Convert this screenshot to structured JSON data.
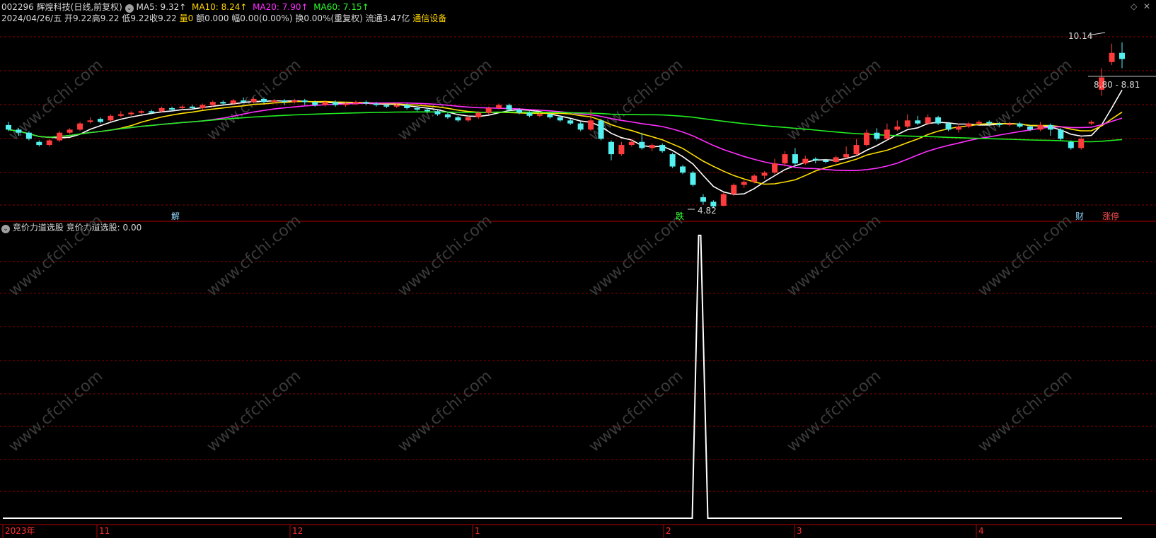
{
  "header": {
    "code": "002296",
    "name": "辉煌科技",
    "period": "(日线,前复权)",
    "ma5": "MA5: 9.32↑",
    "ma10": "MA10: 8.24↑",
    "ma20": "MA20: 7.90↑",
    "ma60": "MA60: 7.15↑",
    "date": "2024/04/26/五",
    "open": "开9.22",
    "high": "高9.22",
    "low": "低9.22",
    "close": "收9.22",
    "vol": "量0",
    "amt": "额0.000",
    "chg": "幅0.00(0.00%)",
    "turn": "换0.00%(重复权)",
    "float": "流通3.47亿",
    "sector": "通信设备"
  },
  "annotations": {
    "high": "10.14",
    "low": "4.82",
    "range": "8.80 - 8.81",
    "jie": "解",
    "die": "跌",
    "cai": "财",
    "zhangting": "涨停"
  },
  "indicator": {
    "name": "竞价力道选股",
    "value_label": "竞价力道选股: 0.00"
  },
  "watermark": "www.cfchi.com",
  "time_axis": [
    "2023年",
    "11",
    "12",
    "1",
    "2",
    "3",
    "4"
  ],
  "colors": {
    "up": "#ff3b3b",
    "down": "#54f0f0",
    "ma5": "#ffffff",
    "ma10": "#ffe000",
    "ma20": "#ff2fff",
    "ma60": "#22ee22",
    "grid": "#8a0000"
  },
  "chart_data": [
    {
      "type": "candlestick",
      "title": "辉煌科技(日线,前复权)",
      "ylim": [
        4.5,
        10.6
      ],
      "candles": [
        [
          7.45,
          7.3,
          7.55,
          7.25
        ],
        [
          7.3,
          7.2,
          7.35,
          7.1
        ],
        [
          7.2,
          7.0,
          7.25,
          6.95
        ],
        [
          6.9,
          6.8,
          6.95,
          6.75
        ],
        [
          6.8,
          6.95,
          7.0,
          6.75
        ],
        [
          6.95,
          7.2,
          7.25,
          6.9
        ],
        [
          7.2,
          7.3,
          7.35,
          7.15
        ],
        [
          7.3,
          7.5,
          7.55,
          7.25
        ],
        [
          7.55,
          7.6,
          7.7,
          7.5
        ],
        [
          7.65,
          7.55,
          7.7,
          7.5
        ],
        [
          7.6,
          7.75,
          7.8,
          7.55
        ],
        [
          7.75,
          7.8,
          7.9,
          7.7
        ],
        [
          7.8,
          7.85,
          7.9,
          7.75
        ],
        [
          7.85,
          7.9,
          7.95,
          7.8
        ],
        [
          7.9,
          7.85,
          7.95,
          7.8
        ],
        [
          7.9,
          8.0,
          8.05,
          7.85
        ],
        [
          8.0,
          7.95,
          8.05,
          7.9
        ],
        [
          8.0,
          8.05,
          8.1,
          7.95
        ],
        [
          8.05,
          8.0,
          8.1,
          7.95
        ],
        [
          8.0,
          8.1,
          8.15,
          7.95
        ],
        [
          8.1,
          8.2,
          8.25,
          8.05
        ],
        [
          8.2,
          8.15,
          8.25,
          8.1
        ],
        [
          8.15,
          8.25,
          8.3,
          8.1
        ],
        [
          8.25,
          8.2,
          8.35,
          8.15
        ],
        [
          8.2,
          8.3,
          8.35,
          8.15
        ],
        [
          8.3,
          8.2,
          8.35,
          8.15
        ],
        [
          8.2,
          8.25,
          8.3,
          8.15
        ],
        [
          8.25,
          8.2,
          8.3,
          8.1
        ],
        [
          8.2,
          8.25,
          8.3,
          8.15
        ],
        [
          8.25,
          8.2,
          8.3,
          8.1
        ],
        [
          8.2,
          8.1,
          8.25,
          8.05
        ],
        [
          8.1,
          8.2,
          8.25,
          8.05
        ],
        [
          8.2,
          8.1,
          8.25,
          8.05
        ],
        [
          8.1,
          8.15,
          8.2,
          8.05
        ],
        [
          8.15,
          8.2,
          8.25,
          8.1
        ],
        [
          8.2,
          8.15,
          8.25,
          8.1
        ],
        [
          8.15,
          8.1,
          8.2,
          8.05
        ],
        [
          8.1,
          8.05,
          8.15,
          8.0
        ],
        [
          8.05,
          8.1,
          8.15,
          8.0
        ],
        [
          8.1,
          8.0,
          8.15,
          7.95
        ],
        [
          8.0,
          7.95,
          8.05,
          7.9
        ],
        [
          7.95,
          7.9,
          8.0,
          7.85
        ],
        [
          7.9,
          7.8,
          7.95,
          7.75
        ],
        [
          7.8,
          7.7,
          7.85,
          7.65
        ],
        [
          7.7,
          7.6,
          7.75,
          7.55
        ],
        [
          7.6,
          7.7,
          7.75,
          7.55
        ],
        [
          7.7,
          7.85,
          7.9,
          7.65
        ],
        [
          7.85,
          8.0,
          8.05,
          7.8
        ],
        [
          8.0,
          8.1,
          8.15,
          7.95
        ],
        [
          8.1,
          7.95,
          8.15,
          7.9
        ],
        [
          7.95,
          7.85,
          8.0,
          7.8
        ],
        [
          7.85,
          7.75,
          7.9,
          7.7
        ],
        [
          7.75,
          7.8,
          7.85,
          7.7
        ],
        [
          7.8,
          7.7,
          7.85,
          7.65
        ],
        [
          7.7,
          7.6,
          7.75,
          7.55
        ],
        [
          7.6,
          7.5,
          7.65,
          7.45
        ],
        [
          7.5,
          7.3,
          7.55,
          7.25
        ],
        [
          7.3,
          7.6,
          7.95,
          7.25
        ],
        [
          7.6,
          7.0,
          7.65,
          6.95
        ],
        [
          6.9,
          6.5,
          6.95,
          6.3
        ],
        [
          6.5,
          6.8,
          6.9,
          6.45
        ],
        [
          6.8,
          6.9,
          7.0,
          6.75
        ],
        [
          6.9,
          6.7,
          7.2,
          6.65
        ],
        [
          6.7,
          6.8,
          6.85,
          6.6
        ],
        [
          6.8,
          6.6,
          6.85,
          6.55
        ],
        [
          6.5,
          6.1,
          6.55,
          6.05
        ],
        [
          6.1,
          5.9,
          6.15,
          5.85
        ],
        [
          5.9,
          5.5,
          5.95,
          5.45
        ],
        [
          5.1,
          4.95,
          5.2,
          4.85
        ],
        [
          4.95,
          4.8,
          5.0,
          4.75
        ],
        [
          4.82,
          5.2,
          5.25,
          4.8
        ],
        [
          5.2,
          5.5,
          5.55,
          5.15
        ],
        [
          5.5,
          5.6,
          5.65,
          5.4
        ],
        [
          5.6,
          5.8,
          5.85,
          5.55
        ],
        [
          5.8,
          5.9,
          5.95,
          5.7
        ],
        [
          5.9,
          6.2,
          6.35,
          5.85
        ],
        [
          6.2,
          6.5,
          6.6,
          6.1
        ],
        [
          6.5,
          6.2,
          6.7,
          6.1
        ],
        [
          6.2,
          6.35,
          6.45,
          6.15
        ],
        [
          6.35,
          6.3,
          6.4,
          6.2
        ],
        [
          6.3,
          6.25,
          6.35,
          6.2
        ],
        [
          6.25,
          6.4,
          6.45,
          6.2
        ],
        [
          6.4,
          6.5,
          6.75,
          6.35
        ],
        [
          6.5,
          6.8,
          7.0,
          6.45
        ],
        [
          6.8,
          7.2,
          7.3,
          6.75
        ],
        [
          7.2,
          7.0,
          7.35,
          6.95
        ],
        [
          7.0,
          7.3,
          7.5,
          6.95
        ],
        [
          7.3,
          7.4,
          7.6,
          7.25
        ],
        [
          7.4,
          7.6,
          7.8,
          7.35
        ],
        [
          7.6,
          7.5,
          7.75,
          7.45
        ],
        [
          7.5,
          7.7,
          7.8,
          7.45
        ],
        [
          7.7,
          7.5,
          7.75,
          7.45
        ],
        [
          7.5,
          7.3,
          7.55,
          7.25
        ],
        [
          7.3,
          7.4,
          7.5,
          7.2
        ],
        [
          7.4,
          7.5,
          7.55,
          7.35
        ],
        [
          7.5,
          7.55,
          7.6,
          7.45
        ],
        [
          7.55,
          7.5,
          7.6,
          7.45
        ],
        [
          7.5,
          7.45,
          7.55,
          7.4
        ],
        [
          7.45,
          7.5,
          7.55,
          7.4
        ],
        [
          7.5,
          7.4,
          7.55,
          7.35
        ],
        [
          7.4,
          7.3,
          7.45,
          7.25
        ],
        [
          7.3,
          7.45,
          7.55,
          7.25
        ],
        [
          7.45,
          7.3,
          7.5,
          7.1
        ],
        [
          7.3,
          7.0,
          7.35,
          6.95
        ],
        [
          6.9,
          6.7,
          6.95,
          6.65
        ],
        [
          6.7,
          7.0,
          7.05,
          6.65
        ],
        [
          7.5,
          7.55,
          7.6,
          7.45
        ],
        [
          8.6,
          9.0,
          9.3,
          8.4
        ],
        [
          9.5,
          9.8,
          10.1,
          9.4
        ],
        [
          9.8,
          9.6,
          10.14,
          9.3
        ]
      ]
    },
    {
      "type": "line",
      "title": "竞价力道选股",
      "x_index_range": [
        0,
        110
      ],
      "ylim": [
        0,
        1
      ],
      "values_note_index": [
        67
      ],
      "series": [
        {
          "name": "竞价力道选股",
          "spike_at": 67,
          "value": 1,
          "baseline": 0
        }
      ]
    }
  ]
}
